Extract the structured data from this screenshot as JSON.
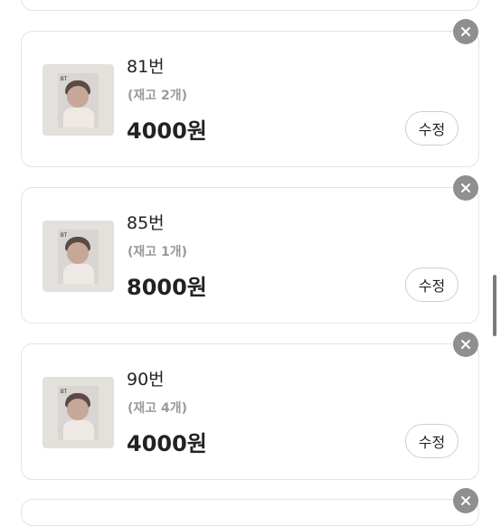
{
  "items": [
    {
      "name": "81번",
      "stock": "(재고 2개)",
      "price": "4000원",
      "edit_label": "수정",
      "thumb_logo": "BT"
    },
    {
      "name": "85번",
      "stock": "(재고 1개)",
      "price": "8000원",
      "edit_label": "수정",
      "thumb_logo": "BT"
    },
    {
      "name": "90번",
      "stock": "(재고 4개)",
      "price": "4000원",
      "edit_label": "수정",
      "thumb_logo": "BT"
    }
  ],
  "icons": {
    "delete": "close-icon",
    "scroll": "scrollbar-thumb"
  },
  "colors": {
    "delete_bg": "#8f8f8f",
    "border": "#e3e3e3",
    "text": "#222222",
    "muted": "#9a9a9a"
  }
}
